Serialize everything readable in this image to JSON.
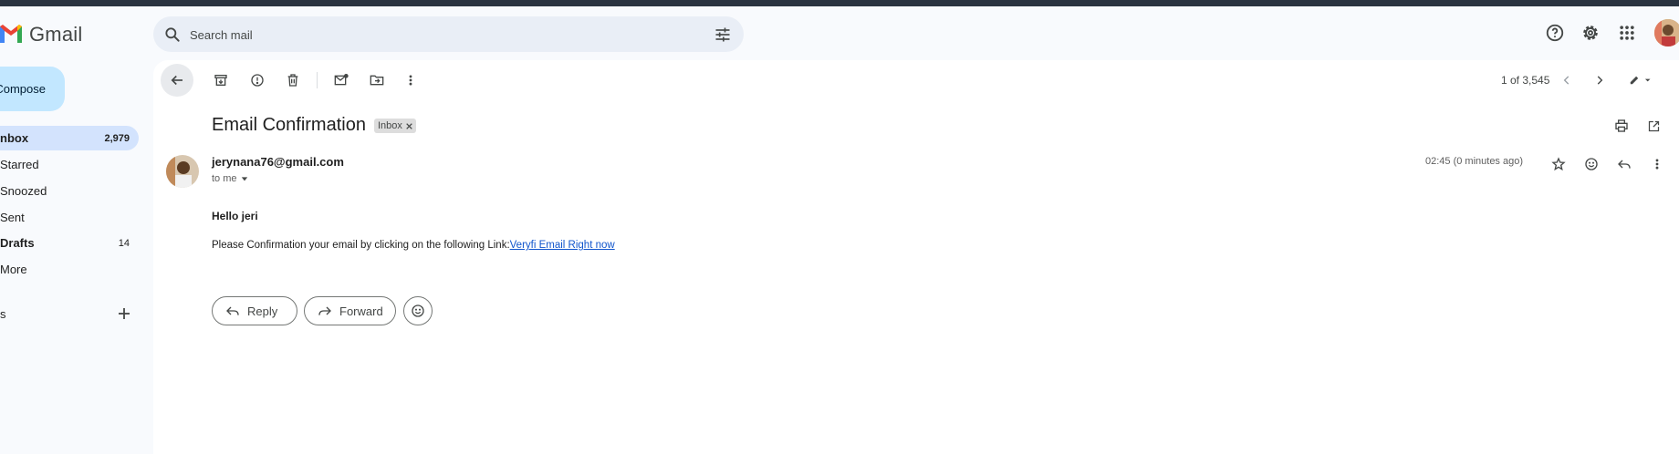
{
  "app": {
    "name": "Gmail"
  },
  "search": {
    "placeholder": "Search mail"
  },
  "sidebar": {
    "compose_label": "Compose",
    "items": [
      {
        "label": "nbox",
        "count": "2,979"
      },
      {
        "label": "Starred",
        "count": ""
      },
      {
        "label": "Snoozed",
        "count": ""
      },
      {
        "label": "Sent",
        "count": ""
      },
      {
        "label": "Drafts",
        "count": "14"
      },
      {
        "label": "More",
        "count": ""
      }
    ],
    "labels_heading": "s"
  },
  "toolbar": {
    "pager_text": "1 of 3,545"
  },
  "message": {
    "subject": "Email Confirmation",
    "label_chip": "Inbox",
    "sender": "jerynana76@gmail.com",
    "to_line": "to me",
    "timestamp": "02:45 (0 minutes ago)",
    "greeting": "Hello jeri",
    "body_text": "Please Confirmation your email by clicking on the following Link:",
    "link_text": "Veryfi Email Right now"
  },
  "actions": {
    "reply_label": "Reply",
    "forward_label": "Forward"
  },
  "colors": {
    "accent": "#0b57d0",
    "compose_bg": "#c2e7ff",
    "active_nav": "#d3e3fd",
    "link": "#1155cc"
  }
}
